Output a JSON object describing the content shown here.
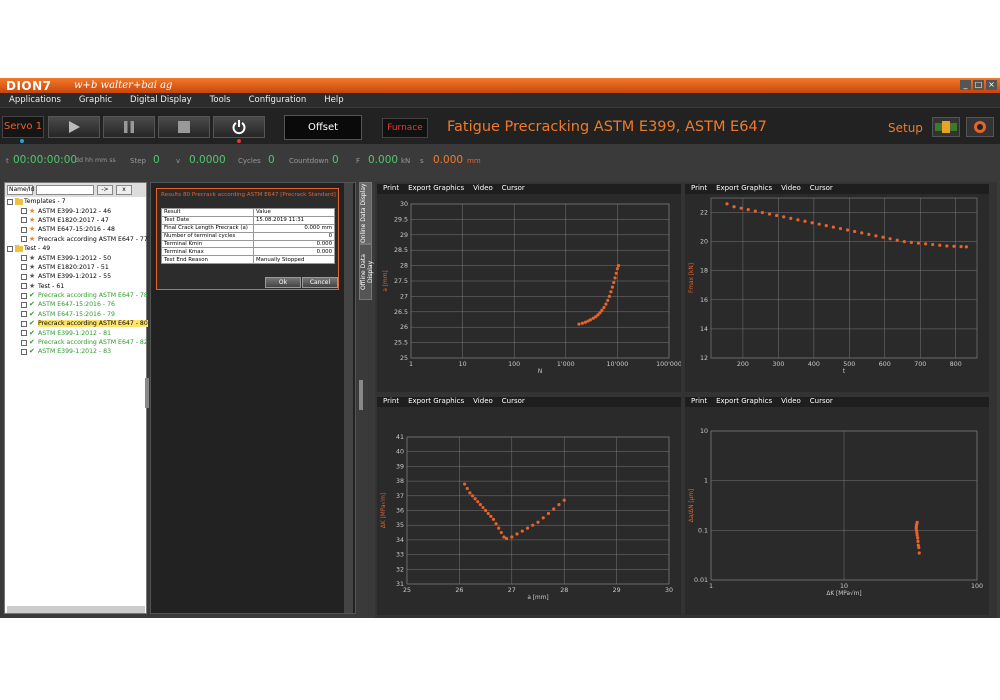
{
  "app": {
    "logo": "DION7",
    "brand": "w+b  walter+bai ag",
    "win_buttons": [
      "_",
      "□",
      "×"
    ]
  },
  "menu": [
    "Applications",
    "Graphic",
    "Digital Display",
    "Tools",
    "Configuration",
    "Help"
  ],
  "toolbar": {
    "servo": "Servo 1",
    "offset": "Offset",
    "furnace": "Furnace",
    "title": "Fatigue Precracking ASTM E399, ASTM E647",
    "setup": "Setup"
  },
  "status": {
    "t_label": "t",
    "time": "00:00:00:00",
    "time_unit": "dd hh mm ss",
    "step_label": "Step",
    "step": "0",
    "v_label": "v",
    "v": "0.0000",
    "cycles_label": "Cycles",
    "cycles": "0",
    "countdown_label": "Countdown",
    "countdown": "0",
    "f_label": "F",
    "f": "0.000",
    "f_unit": "kN",
    "s_label": "s",
    "s": "0.000",
    "s_unit": "mm"
  },
  "tree": {
    "search_label": "Name/Id",
    "btn_go": "->",
    "btn_clear": "x",
    "items": [
      {
        "text": "Templates - 7",
        "icon": "folder",
        "level": 0,
        "color": "black"
      },
      {
        "text": "ASTM E399-1:2012 - 46",
        "icon": "star-orange",
        "level": 1,
        "color": "black"
      },
      {
        "text": "ASTM E1820:2017 - 47",
        "icon": "star-orange",
        "level": 1,
        "color": "black"
      },
      {
        "text": "ASTM E647-15:2016 - 48",
        "icon": "star-orange",
        "level": 1,
        "color": "black"
      },
      {
        "text": "Precrack according ASTM E647 - 77",
        "icon": "star-orange",
        "level": 1,
        "color": "black"
      },
      {
        "text": "Test - 49",
        "icon": "folder",
        "level": 0,
        "color": "black"
      },
      {
        "text": "ASTM E399-1:2012 - 50",
        "icon": "star-dark",
        "level": 1,
        "color": "black"
      },
      {
        "text": "ASTM E1820:2017 - 51",
        "icon": "star-dark",
        "level": 1,
        "color": "black"
      },
      {
        "text": "ASTM E399-1:2012 - 55",
        "icon": "star-dark",
        "level": 1,
        "color": "black"
      },
      {
        "text": "Test - 61",
        "icon": "star-dark",
        "level": 1,
        "color": "black"
      },
      {
        "text": "Precrack according ASTM E647 - 78",
        "icon": "check",
        "level": 1,
        "color": "green"
      },
      {
        "text": "ASTM E647-15:2016 - 76",
        "icon": "check",
        "level": 1,
        "color": "green"
      },
      {
        "text": "ASTM E647-15:2016 - 79",
        "icon": "check",
        "level": 1,
        "color": "green"
      },
      {
        "text": "Precrack according ASTM E647 - 80",
        "icon": "check",
        "level": 1,
        "color": "green",
        "selected": true
      },
      {
        "text": "ASTM E399-1:2012 - 81",
        "icon": "check",
        "level": 1,
        "color": "green"
      },
      {
        "text": "Precrack according ASTM E647 - 82",
        "icon": "check",
        "level": 1,
        "color": "green"
      },
      {
        "text": "ASTM E399-1:2012 - 83",
        "icon": "check",
        "level": 1,
        "color": "green"
      }
    ]
  },
  "dialog": {
    "title": "Results 80 Precrack according ASTM E647 [Precrack Standard]",
    "headers": [
      "Result",
      "Value"
    ],
    "rows": [
      [
        "Test Date",
        "15.08.2019 11:31"
      ],
      [
        "Final Crack Length Precrack (a)",
        "0.000 mm"
      ],
      [
        "Number of terminal cycles",
        "0"
      ],
      [
        "Terminal Kmin",
        "0.000"
      ],
      [
        "Terminal Kmax",
        "0.000"
      ],
      [
        "Test End Reason",
        "Manually Stopped"
      ]
    ],
    "ok": "Ok",
    "cancel": "Cancel"
  },
  "side_tabs": [
    "Online Data Display",
    "Offline Data Display"
  ],
  "chart_menu": [
    "Print",
    "Export Graphics",
    "Video",
    "Cursor"
  ],
  "colors": {
    "accent": "#e8622a",
    "green": "#4dc86a"
  },
  "chart_data": [
    {
      "type": "scatter",
      "xlabel": "N",
      "ylabel": "a [mm]",
      "xscale": "log",
      "xlim": [
        1,
        100000
      ],
      "ylim": [
        25,
        30
      ],
      "xticks": [
        "1",
        "10",
        "100",
        "1'000",
        "10'000",
        "100'000"
      ],
      "yticks": [
        "25",
        "25.5",
        "26",
        "26.5",
        "27",
        "27.5",
        "28",
        "28.5",
        "29",
        "29.5",
        "30"
      ],
      "points": [
        [
          1800,
          26.1
        ],
        [
          2100,
          26.13
        ],
        [
          2400,
          26.16
        ],
        [
          2700,
          26.2
        ],
        [
          3000,
          26.24
        ],
        [
          3400,
          26.29
        ],
        [
          3800,
          26.34
        ],
        [
          4200,
          26.4
        ],
        [
          4600,
          26.47
        ],
        [
          5000,
          26.55
        ],
        [
          5500,
          26.64
        ],
        [
          6000,
          26.75
        ],
        [
          6500,
          26.87
        ],
        [
          7000,
          27.0
        ],
        [
          7500,
          27.15
        ],
        [
          8000,
          27.3
        ],
        [
          8500,
          27.45
        ],
        [
          9000,
          27.6
        ],
        [
          9500,
          27.75
        ],
        [
          10000,
          27.9
        ],
        [
          10500,
          28.0
        ]
      ]
    },
    {
      "type": "scatter",
      "xlabel": "t",
      "ylabel": "Fmax [kN]",
      "xscale": "linear",
      "xlim": [
        110,
        860
      ],
      "ylim": [
        12,
        23
      ],
      "xticks": [
        "200",
        "300",
        "400",
        "500",
        "600",
        "700",
        "800"
      ],
      "yticks": [
        "12",
        "14",
        "16",
        "18",
        "20",
        "22"
      ],
      "points": [
        [
          155,
          22.6
        ],
        [
          175,
          22.4
        ],
        [
          195,
          22.3
        ],
        [
          215,
          22.2
        ],
        [
          235,
          22.1
        ],
        [
          255,
          22.0
        ],
        [
          275,
          21.9
        ],
        [
          295,
          21.8
        ],
        [
          315,
          21.7
        ],
        [
          335,
          21.6
        ],
        [
          355,
          21.5
        ],
        [
          375,
          21.4
        ],
        [
          395,
          21.3
        ],
        [
          415,
          21.2
        ],
        [
          435,
          21.1
        ],
        [
          455,
          21.0
        ],
        [
          475,
          20.9
        ],
        [
          495,
          20.8
        ],
        [
          515,
          20.7
        ],
        [
          535,
          20.6
        ],
        [
          555,
          20.5
        ],
        [
          575,
          20.4
        ],
        [
          595,
          20.3
        ],
        [
          615,
          20.2
        ],
        [
          635,
          20.1
        ],
        [
          655,
          20.0
        ],
        [
          675,
          19.95
        ],
        [
          695,
          19.9
        ],
        [
          715,
          19.85
        ],
        [
          735,
          19.8
        ],
        [
          755,
          19.75
        ],
        [
          775,
          19.7
        ],
        [
          795,
          19.68
        ],
        [
          815,
          19.66
        ],
        [
          830,
          19.64
        ]
      ]
    },
    {
      "type": "scatter",
      "xlabel": "a [mm]",
      "ylabel": "ΔK [MPa√m]",
      "xscale": "linear",
      "xlim": [
        25,
        30
      ],
      "ylim": [
        31,
        41
      ],
      "xticks": [
        "25",
        "26",
        "27",
        "28",
        "29",
        "30"
      ],
      "yticks": [
        "31",
        "32",
        "33",
        "34",
        "35",
        "36",
        "37",
        "38",
        "39",
        "40",
        "41"
      ],
      "points": [
        [
          26.1,
          37.8
        ],
        [
          26.15,
          37.5
        ],
        [
          26.2,
          37.2
        ],
        [
          26.25,
          37.0
        ],
        [
          26.3,
          36.8
        ],
        [
          26.35,
          36.6
        ],
        [
          26.4,
          36.4
        ],
        [
          26.45,
          36.2
        ],
        [
          26.5,
          36.0
        ],
        [
          26.55,
          35.8
        ],
        [
          26.6,
          35.6
        ],
        [
          26.65,
          35.4
        ],
        [
          26.7,
          35.1
        ],
        [
          26.75,
          34.8
        ],
        [
          26.8,
          34.5
        ],
        [
          26.85,
          34.2
        ],
        [
          26.9,
          34.1
        ],
        [
          27.0,
          34.2
        ],
        [
          27.1,
          34.4
        ],
        [
          27.2,
          34.6
        ],
        [
          27.3,
          34.8
        ],
        [
          27.4,
          35.0
        ],
        [
          27.5,
          35.2
        ],
        [
          27.6,
          35.5
        ],
        [
          27.7,
          35.8
        ],
        [
          27.8,
          36.1
        ],
        [
          27.9,
          36.4
        ],
        [
          28.0,
          36.7
        ]
      ]
    },
    {
      "type": "scatter",
      "xlabel": "ΔK [MPa√m]",
      "ylabel": "Δa/ΔN [µm]",
      "xscale": "log",
      "yscale": "log",
      "xlim": [
        1,
        100
      ],
      "ylim": [
        0.01,
        10
      ],
      "xticks": [
        "1",
        "10",
        "100"
      ],
      "yticks": [
        "0.01",
        "0.1",
        "1",
        "10"
      ],
      "points": [
        [
          35.5,
          0.145
        ],
        [
          35.2,
          0.132
        ],
        [
          35.0,
          0.12
        ],
        [
          34.9,
          0.11
        ],
        [
          35.1,
          0.1
        ],
        [
          35.3,
          0.09
        ],
        [
          35.5,
          0.08
        ],
        [
          35.8,
          0.07
        ],
        [
          36.0,
          0.06
        ],
        [
          36.2,
          0.05
        ],
        [
          36.5,
          0.045
        ],
        [
          36.8,
          0.035
        ]
      ]
    }
  ]
}
